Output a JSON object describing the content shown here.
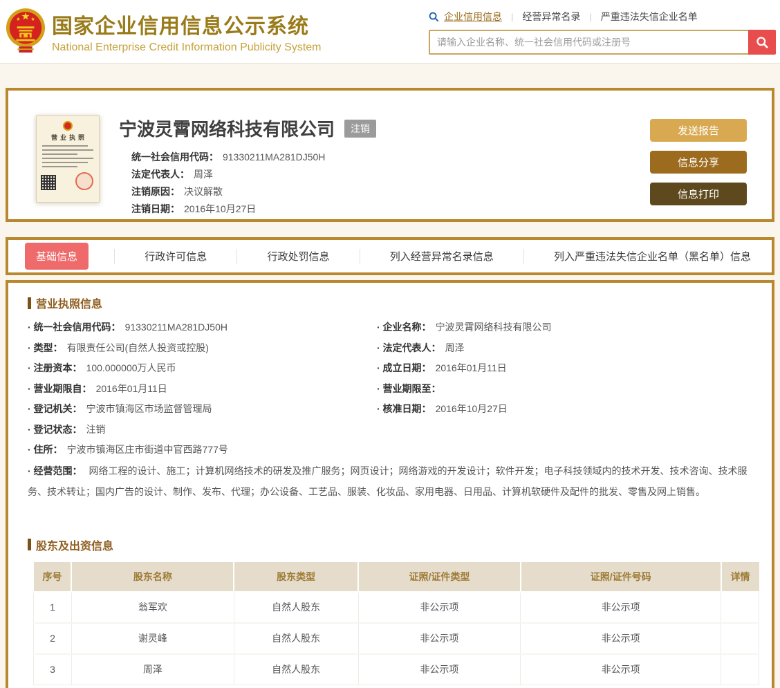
{
  "colors": {
    "gold_border": "#b9882e",
    "title_gold": "#9a7b1a",
    "subtitle_gold": "#c6a23c",
    "search_button_red": "#e84c4c",
    "tab_active_red": "#ef6b6b",
    "button_send_report": "#d8a951",
    "button_share": "#9d6b1e",
    "button_print": "#5d491d",
    "status_badge_gray": "#9b9b9b",
    "section_brown": "#8f5f21",
    "table_header_bg": "#e6dccb",
    "table_header_text": "#9c7b35",
    "page_background": "#faf6ed"
  },
  "header": {
    "title": "国家企业信用信息公示系统",
    "subtitle": "National Enterprise Credit Information Publicity System",
    "nav": [
      {
        "label": "企业信用信息",
        "active": true
      },
      {
        "label": "经营异常名录",
        "active": false
      },
      {
        "label": "严重违法失信企业名单",
        "active": false
      }
    ],
    "search_placeholder": "请输入企业名称、统一社会信用代码或注册号"
  },
  "company": {
    "name": "宁波灵霄网络科技有限公司",
    "status_badge": "注销",
    "license_label": "营业执照",
    "fields": [
      {
        "label": "统一社会信用代码：",
        "value": "91330211MA281DJ50H"
      },
      {
        "label": "法定代表人：",
        "value": "周泽"
      },
      {
        "label": "注销原因：",
        "value": "决议解散"
      },
      {
        "label": "注销日期：",
        "value": "2016年10月27日"
      }
    ],
    "buttons": [
      "发送报告",
      "信息分享",
      "信息打印"
    ]
  },
  "tabs": [
    {
      "label": "基础信息",
      "active": true
    },
    {
      "label": "行政许可信息",
      "active": false
    },
    {
      "label": "行政处罚信息",
      "active": false
    },
    {
      "label": "列入经营异常名录信息",
      "active": false
    },
    {
      "label": "列入严重违法失信企业名单（黑名单）信息",
      "active": false
    }
  ],
  "license_section": {
    "title": "营业执照信息",
    "rows": [
      {
        "left": {
          "label": "· 统一社会信用代码：",
          "value": "91330211MA281DJ50H"
        },
        "right": {
          "label": "· 企业名称：",
          "value": "宁波灵霄网络科技有限公司"
        }
      },
      {
        "left": {
          "label": "· 类型：",
          "value": "有限责任公司(自然人投资或控股)"
        },
        "right": {
          "label": "· 法定代表人：",
          "value": "周泽"
        }
      },
      {
        "left": {
          "label": "· 注册资本：",
          "value": "100.000000万人民币"
        },
        "right": {
          "label": "· 成立日期：",
          "value": "2016年01月11日"
        }
      },
      {
        "left": {
          "label": "· 营业期限自：",
          "value": "2016年01月11日"
        },
        "right": {
          "label": "· 营业期限至：",
          "value": ""
        }
      },
      {
        "left": {
          "label": "· 登记机关：",
          "value": "宁波市镇海区市场监督管理局"
        },
        "right": {
          "label": "· 核准日期：",
          "value": "2016年10月27日"
        }
      },
      {
        "left": {
          "label": "· 登记状态：",
          "value": "注销"
        },
        "right": null
      },
      {
        "left": {
          "label": "· 住所：",
          "value": "宁波市镇海区庄市街道中官西路777号"
        },
        "right": null
      }
    ],
    "scope": {
      "label": "· 经营范围：",
      "value": "网络工程的设计、施工；计算机网络技术的研发及推广服务；网页设计；网络游戏的开发设计；软件开发；电子科技领域内的技术开发、技术咨询、技术服务、技术转让；国内广告的设计、制作、发布、代理；办公设备、工艺品、服装、化妆品、家用电器、日用品、计算机软硬件及配件的批发、零售及网上销售。"
    }
  },
  "shareholders": {
    "title": "股东及出资信息",
    "columns": [
      "序号",
      "股东名称",
      "股东类型",
      "证照/证件类型",
      "证照/证件号码",
      "详情"
    ],
    "rows": [
      [
        "1",
        "翁军欢",
        "自然人股东",
        "非公示项",
        "非公示项",
        ""
      ],
      [
        "2",
        "谢灵峰",
        "自然人股东",
        "非公示项",
        "非公示项",
        ""
      ],
      [
        "3",
        "周泽",
        "自然人股东",
        "非公示项",
        "非公示项",
        ""
      ]
    ]
  }
}
